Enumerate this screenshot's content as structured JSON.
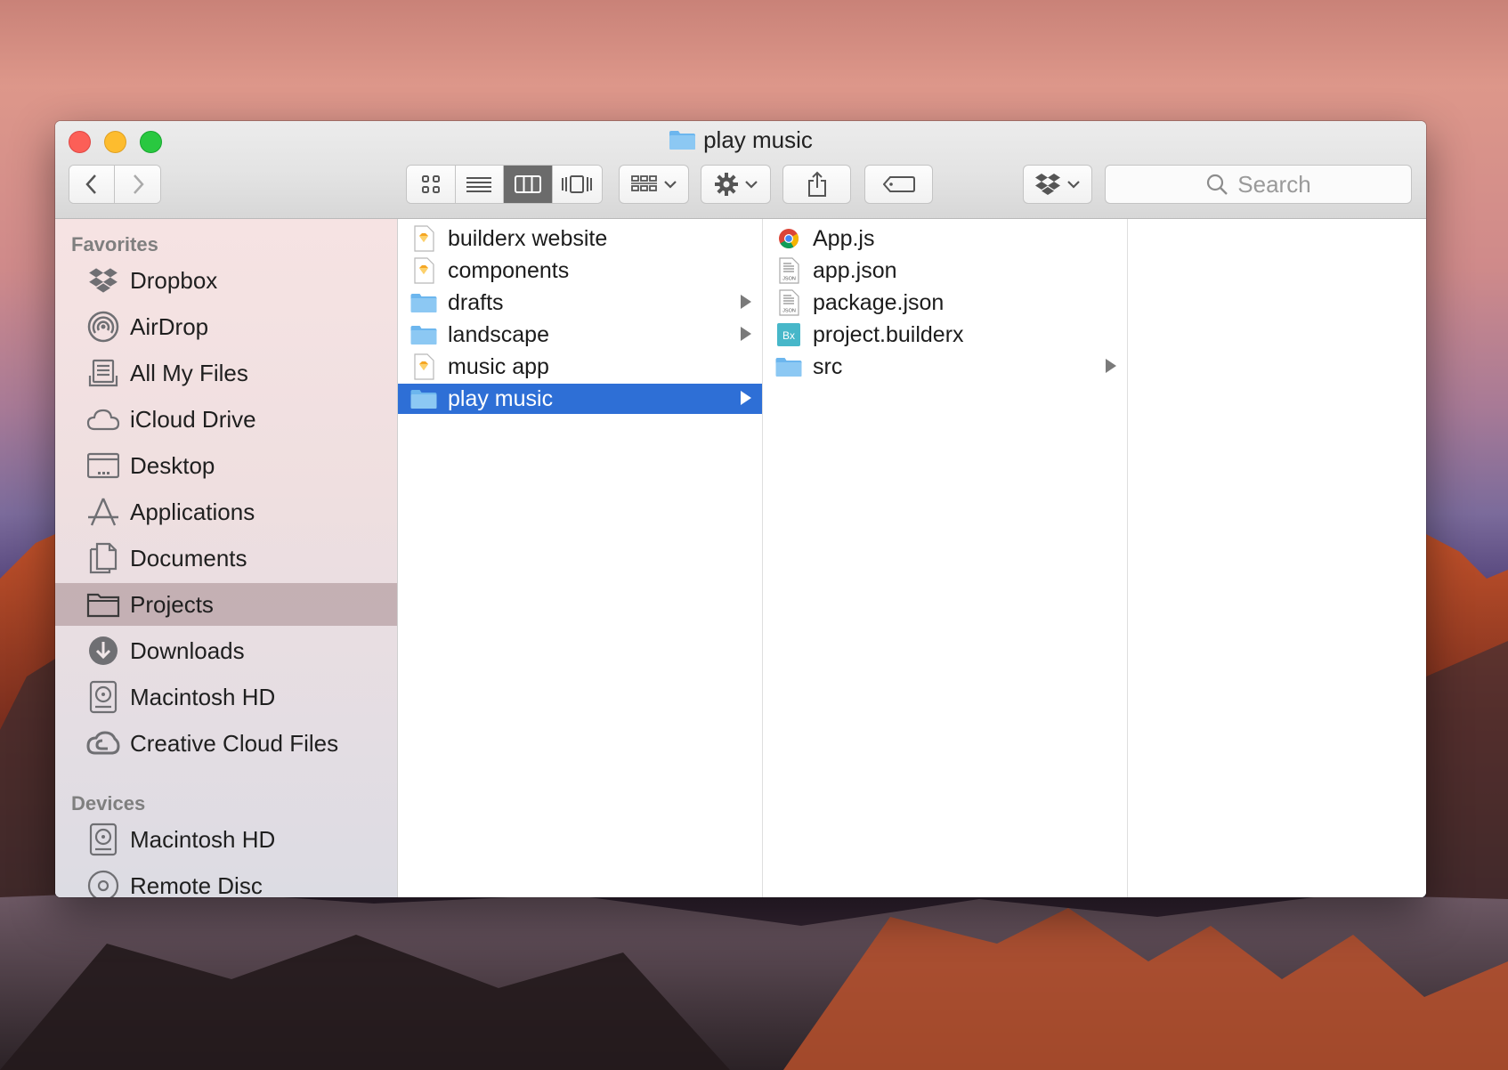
{
  "window": {
    "title": "play music"
  },
  "toolbar": {
    "back": "back",
    "forward": "forward",
    "view_modes": [
      "icon-view",
      "list-view",
      "column-view",
      "cover-flow-view"
    ],
    "active_view": "column-view",
    "search_placeholder": "Search"
  },
  "sidebar": {
    "favorites_header": "Favorites",
    "favorites": [
      {
        "label": "Dropbox",
        "icon": "dropbox-icon"
      },
      {
        "label": "AirDrop",
        "icon": "airdrop-icon"
      },
      {
        "label": "All My Files",
        "icon": "all-files-icon"
      },
      {
        "label": "iCloud Drive",
        "icon": "cloud-icon"
      },
      {
        "label": "Desktop",
        "icon": "desktop-icon"
      },
      {
        "label": "Applications",
        "icon": "applications-icon"
      },
      {
        "label": "Documents",
        "icon": "documents-icon"
      },
      {
        "label": "Projects",
        "icon": "folder-icon",
        "selected": true
      },
      {
        "label": "Downloads",
        "icon": "downloads-icon"
      },
      {
        "label": "Macintosh HD",
        "icon": "hard-drive-icon"
      },
      {
        "label": "Creative Cloud Files",
        "icon": "creative-cloud-icon"
      }
    ],
    "devices_header": "Devices",
    "devices": [
      {
        "label": "Macintosh HD",
        "icon": "hard-drive-icon"
      },
      {
        "label": "Remote Disc",
        "icon": "disc-icon"
      }
    ]
  },
  "columns": {
    "col1": [
      {
        "label": "builderx website",
        "icon": "sketch-file-icon",
        "folder": false
      },
      {
        "label": "components",
        "icon": "sketch-file-icon",
        "folder": false
      },
      {
        "label": "drafts",
        "icon": "folder-icon",
        "folder": true
      },
      {
        "label": "landscape",
        "icon": "folder-icon",
        "folder": true
      },
      {
        "label": "music app",
        "icon": "sketch-file-icon",
        "folder": false
      },
      {
        "label": "play music",
        "icon": "folder-icon",
        "folder": true,
        "selected": true
      }
    ],
    "col2": [
      {
        "label": "App.js",
        "icon": "chrome-file-icon",
        "folder": false
      },
      {
        "label": "app.json",
        "icon": "json-file-icon",
        "folder": false
      },
      {
        "label": "package.json",
        "icon": "json-file-icon",
        "folder": false
      },
      {
        "label": "project.builderx",
        "icon": "builderx-file-icon",
        "folder": false
      },
      {
        "label": "src",
        "icon": "folder-icon",
        "folder": true
      }
    ]
  },
  "colors": {
    "selection": "#2e6fd6",
    "sidebar_selection": "#b39da1",
    "folder": "#6cb6ee"
  }
}
